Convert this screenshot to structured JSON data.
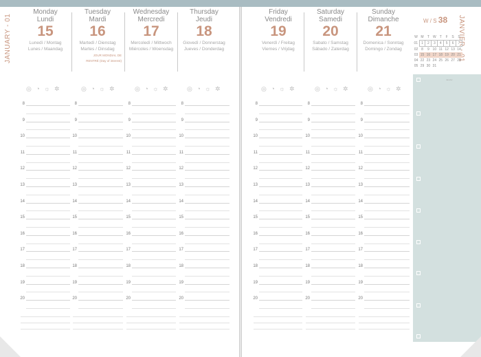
{
  "left_page": {
    "side_title": "JANUARY - 01",
    "days": [
      {
        "en": "Monday",
        "fr": "Lundi",
        "num": "15",
        "saint1": "Lunedì / Montag",
        "saint2": "Lunes / Maandag",
        "event1": "",
        "event2": ""
      },
      {
        "en": "Tuesday",
        "fr": "Mardi",
        "num": "16",
        "saint1": "Martedì / Dienstag",
        "saint2": "Martes / Dinsdag",
        "event1": "JOUR MONDIAL DE",
        "event2": "RENTRÉ (Day of interest)"
      },
      {
        "en": "Wednesday",
        "fr": "Mercredi",
        "num": "17",
        "saint1": "Mercoledì / Mittwoch",
        "saint2": "Miércoles / Woensdag",
        "event1": "",
        "event2": ""
      },
      {
        "en": "Thursday",
        "fr": "Jeudi",
        "num": "18",
        "saint1": "Giovedì / Donnerstag",
        "saint2": "Jueves / Donderdag",
        "event1": "",
        "event2": ""
      }
    ]
  },
  "right_page": {
    "side_title": "JANVIER - 01",
    "days": [
      {
        "en": "Friday",
        "fr": "Vendredi",
        "num": "19",
        "saint1": "Venerdì / Freitag",
        "saint2": "Viernes / Vrijdag"
      },
      {
        "en": "Saturday",
        "fr": "Samedi",
        "num": "20",
        "saint1": "Sabato / Samstag",
        "saint2": "Sábado / Zaterdag"
      },
      {
        "en": "Sunday",
        "fr": "Dimanche",
        "num": "21",
        "saint1": "Domenica / Sonntag",
        "saint2": "Domingo / Zondag"
      }
    ]
  },
  "week": {
    "label": "W / S",
    "number": "38"
  },
  "mini_calendar": {
    "headers": [
      "W",
      "M",
      "T",
      "W",
      "T",
      "F",
      "S",
      "S"
    ],
    "rows": [
      [
        "01",
        "1",
        "2",
        "3",
        "4",
        "5",
        "6",
        "7"
      ],
      [
        "02",
        "8",
        "9",
        "10",
        "11",
        "12",
        "13",
        "14"
      ],
      [
        "03",
        "15",
        "16",
        "17",
        "18",
        "19",
        "20",
        "21"
      ],
      [
        "04",
        "22",
        "23",
        "24",
        "25",
        "26",
        "27",
        "28"
      ],
      [
        "05",
        "29",
        "30",
        "31",
        "",
        "",
        "",
        ""
      ]
    ],
    "foot": "Janvier"
  },
  "hours": [
    "8",
    "9",
    "10",
    "11",
    "12",
    "13",
    "14",
    "15",
    "16",
    "17",
    "18",
    "19",
    "20"
  ],
  "moon_symbols": "◎ ◔ ☼ ✲",
  "colors": {
    "accent": "#c8957e",
    "sidebar": "#d3e0df",
    "topbar": "#a9bcc2"
  }
}
